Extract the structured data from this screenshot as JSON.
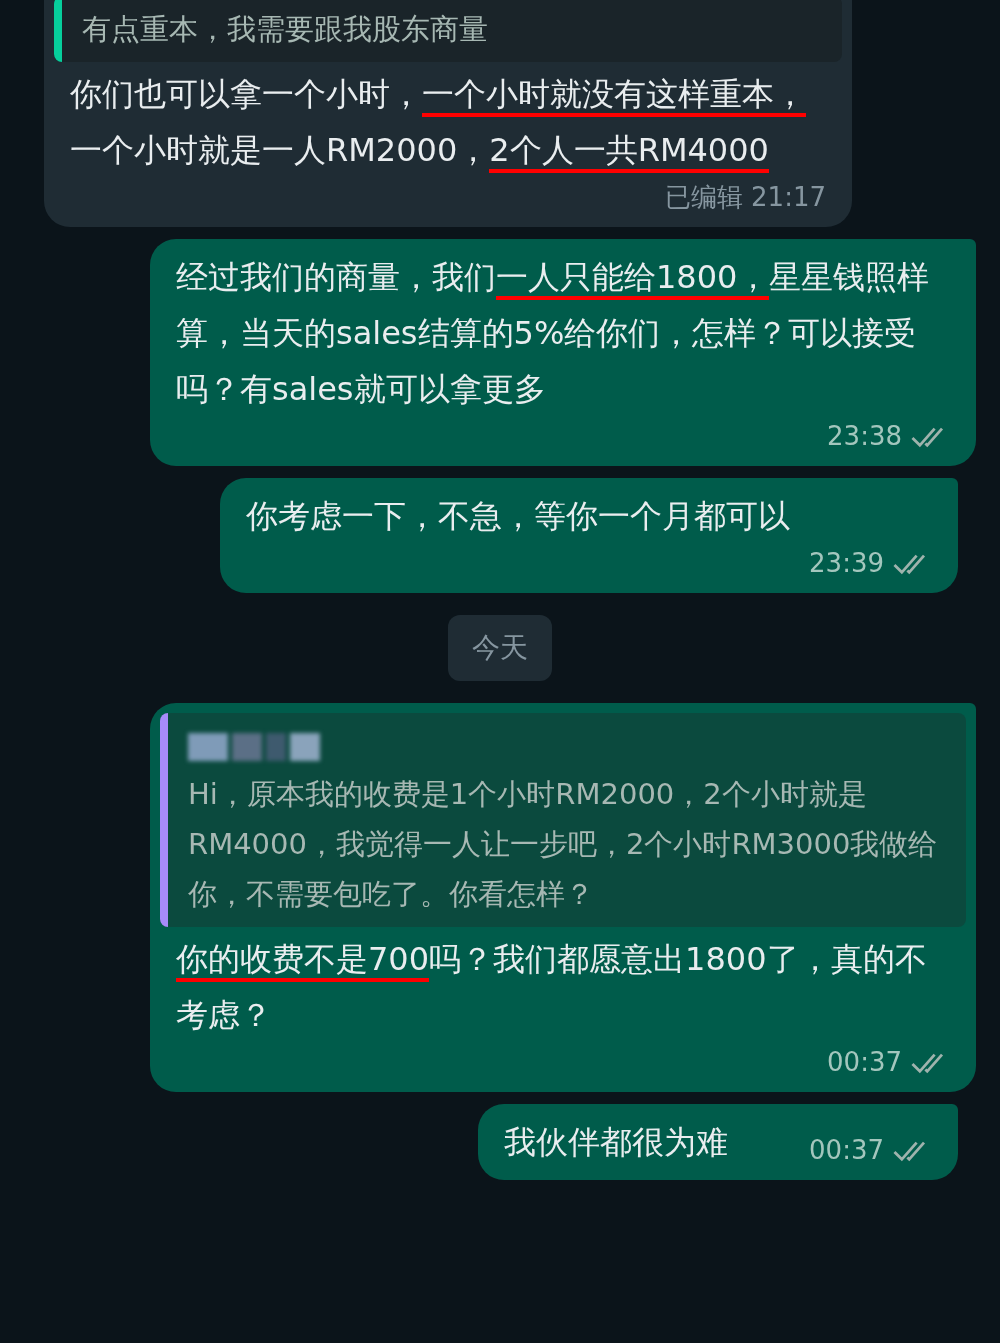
{
  "messages": [
    {
      "kind": "incoming",
      "quote": {
        "text": "有点重本，我需要跟我股东商量"
      },
      "segments": [
        {
          "text": "你们也可以拿一个小时，",
          "underlined": false
        },
        {
          "text": "一个小时就没有这样重本，",
          "underlined": true
        },
        {
          "text": "一个小时就是一人RM2000，",
          "underlined": false
        },
        {
          "text": "2个人一共RM4000",
          "underlined": true
        }
      ],
      "edited": "已编辑",
      "time": "21:17"
    },
    {
      "kind": "outgoing",
      "segments": [
        {
          "text": "经过我们的商量，我们",
          "underlined": false
        },
        {
          "text": "一人只能给1800，",
          "underlined": true
        },
        {
          "text": "星星钱照样算，当天的sales结算的5%给你们，怎样？可以接受吗？有sales就可以拿更多",
          "underlined": false
        }
      ],
      "time": "23:38",
      "read": false
    },
    {
      "kind": "outgoing",
      "text": "你考虑一下，不急，等你一个月都可以",
      "time": "23:39",
      "read": false
    },
    {
      "kind": "date",
      "label": "今天"
    },
    {
      "kind": "outgoing",
      "quote": {
        "text": "Hi，原本我的收费是1个小时RM2000，2个小时就是RM4000，我觉得一人让一步吧，2个小时RM3000我做给你，不需要包吃了。你看怎样？",
        "author_hidden": true
      },
      "segments": [
        {
          "text": "你的收费不是700",
          "underlined": true
        },
        {
          "text": "吗？我们都愿意出1800了，真的不考虑？",
          "underlined": false
        }
      ],
      "time": "00:37",
      "read": false
    },
    {
      "kind": "outgoing",
      "text": "我伙伴都很为难",
      "time": "00:37",
      "read": false
    }
  ]
}
